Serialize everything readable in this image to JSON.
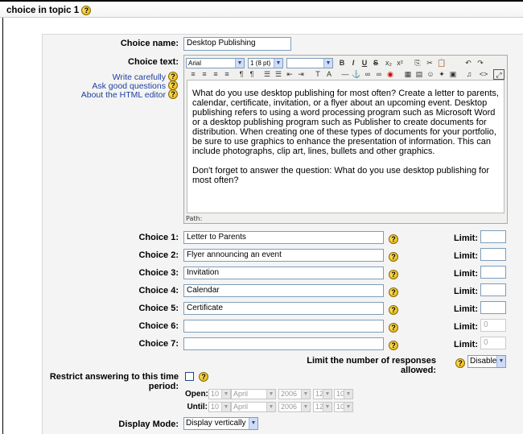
{
  "page": {
    "title": "choice in topic 1"
  },
  "form": {
    "name_label": "Choice name:",
    "name_value": "Desktop Publishing",
    "text_label": "Choice text:",
    "help_links": [
      "Write carefully",
      "Ask good questions",
      "About the HTML editor"
    ],
    "editor": {
      "font": "Arial",
      "size": "1 (8 pt)",
      "style": "",
      "paragraph1": "What do you use desktop publishing for most often? Create a letter to parents, calendar, certificate, invitation, or a flyer about an upcoming event. Desktop publishing refers to using a word processing program such as Microsoft Word or a desktop publishing program such as Publisher to create documents for distribution. When creating one of these types of documents for your portfolio, be sure to use graphics to enhance the presentation of information. This can include photographs, clip art, lines, bullets and other graphics.",
      "paragraph2": "Don't forget to answer the question: What do you use desktop publishing for most often?",
      "path_label": "Path:"
    },
    "choices": [
      {
        "label": "Choice 1:",
        "value": "Letter to Parents",
        "limit_label": "Limit:",
        "limit": ""
      },
      {
        "label": "Choice 2:",
        "value": "Flyer announcing an event",
        "limit_label": "Limit:",
        "limit": ""
      },
      {
        "label": "Choice 3:",
        "value": "Invitation",
        "limit_label": "Limit:",
        "limit": ""
      },
      {
        "label": "Choice 4:",
        "value": "Calendar",
        "limit_label": "Limit:",
        "limit": ""
      },
      {
        "label": "Choice 5:",
        "value": "Certificate",
        "limit_label": "Limit:",
        "limit": ""
      },
      {
        "label": "Choice 6:",
        "value": "",
        "limit_label": "Limit:",
        "limit": "0"
      },
      {
        "label": "Choice 7:",
        "value": "",
        "limit_label": "Limit:",
        "limit": "0"
      }
    ],
    "limit_responses_label": "Limit the number of responses allowed:",
    "limit_responses_value": "Disable",
    "restrict_label": "Restrict answering to this time period:",
    "open_label": "Open:",
    "until_label": "Until:",
    "open": {
      "day": "10",
      "month": "April",
      "year": "2006",
      "hour": "12",
      "minute": "10"
    },
    "until": {
      "day": "10",
      "month": "April",
      "year": "2006",
      "hour": "12",
      "minute": "10"
    },
    "display_mode_label": "Display Mode:",
    "display_mode_value": "Display vertically"
  },
  "toolbar": {
    "row1": [
      "B",
      "I",
      "U",
      "S",
      "x₂",
      "x²",
      "⎘",
      "✂",
      "📋",
      "↶",
      "↷"
    ],
    "row2": [
      "≡",
      "≡",
      "≡",
      "≡",
      "¶",
      "¶",
      "☰",
      "☰",
      "⇤",
      "⇥",
      "T",
      "A",
      "—",
      "⚓",
      "∞",
      "∞",
      "◉",
      "▦",
      "▤",
      "☺",
      "✦",
      "▣",
      "♫",
      "<>",
      "⤢"
    ]
  }
}
